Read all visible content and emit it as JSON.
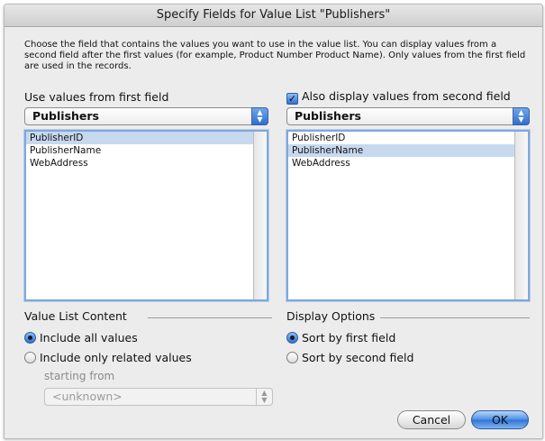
{
  "dialog": {
    "title": "Specify Fields for Value List \"Publishers\"",
    "description": "Choose the field that contains the values you want to use in the value list. You can display values from a second field after the first values (for example, Product Number Product Name). Only values from the first field are used in the records."
  },
  "left": {
    "heading": "Use values from first field",
    "table_popup": "Publishers",
    "fields": [
      "PublisherID",
      "PublisherName",
      "WebAddress"
    ],
    "selected_index": 0
  },
  "right": {
    "checkbox_label": "Also display values from second field",
    "checkbox_checked": true,
    "table_popup": "Publishers",
    "fields": [
      "PublisherID",
      "PublisherName",
      "WebAddress"
    ],
    "selected_index": 1
  },
  "value_list_content": {
    "heading": "Value List Content",
    "option_all": "Include all values",
    "option_related": "Include only related values",
    "selected": "all",
    "starting_from_label": "starting from",
    "starting_from_value": "<unknown>"
  },
  "display_options": {
    "heading": "Display Options",
    "option_first": "Sort by first field",
    "option_second": "Sort by second field",
    "selected": "first"
  },
  "buttons": {
    "cancel": "Cancel",
    "ok": "OK"
  }
}
